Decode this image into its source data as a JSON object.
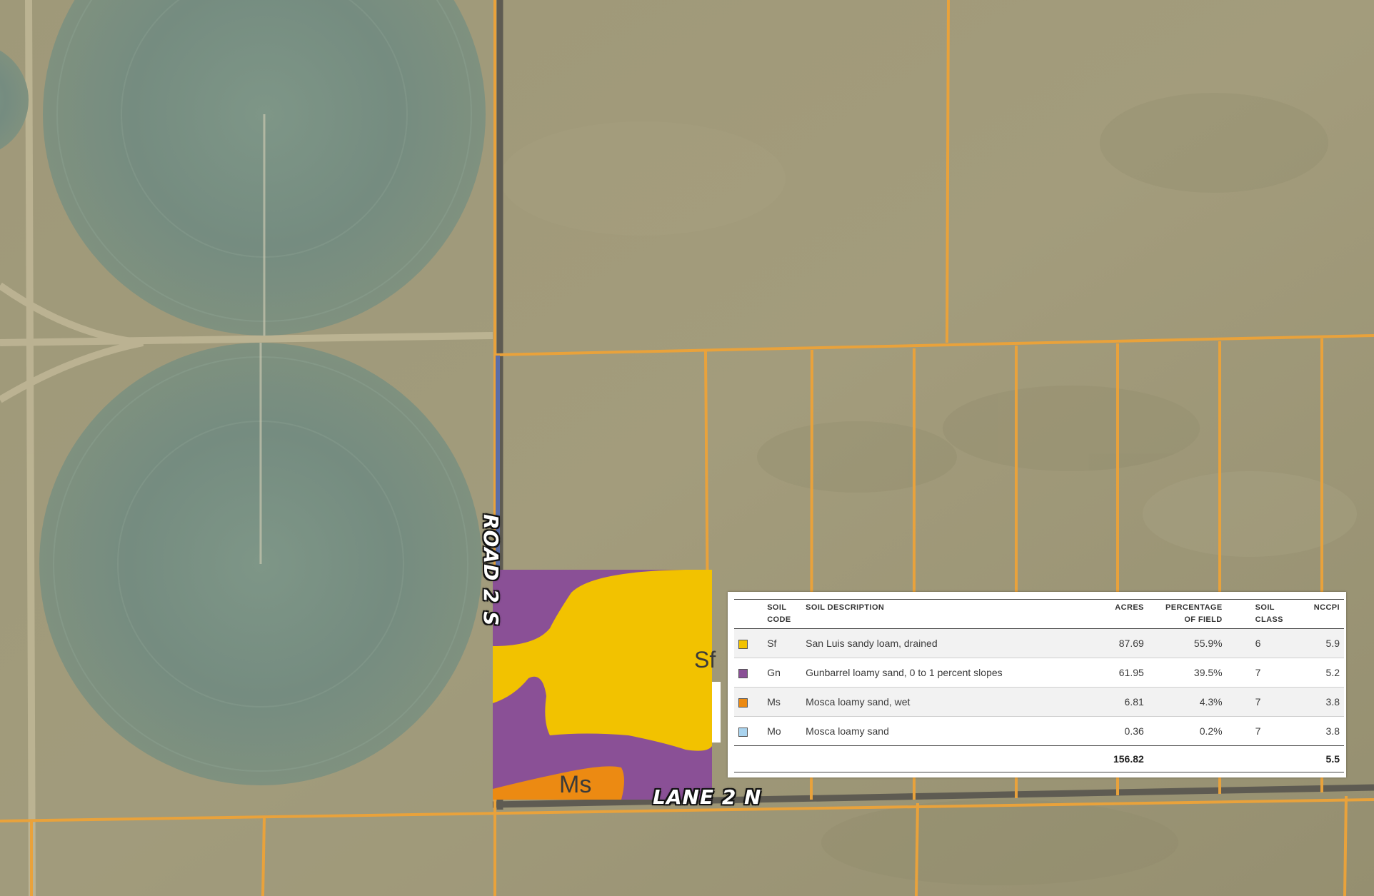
{
  "map": {
    "road_vertical_label": "ROAD 2 S",
    "road_horizontal_label": "LANE 2 N",
    "field_labels": [
      "Sf",
      "Ms"
    ],
    "colors": {
      "parcel_line": "#e9a23b",
      "field_boundary": "#5b6ea8",
      "Sf": "#f2c200",
      "Gn": "#8a5096",
      "Ms": "#ec8a12",
      "Mo": "#a9d3ee"
    }
  },
  "soil_table": {
    "headers": {
      "code": "SOIL CODE",
      "description": "SOIL DESCRIPTION",
      "acres": "ACRES",
      "percent": "PERCENTAGE OF FIELD",
      "class": "SOIL CLASS",
      "nccpi": "NCCPI"
    },
    "rows": [
      {
        "color": "#f2c200",
        "code": "Sf",
        "description": "San Luis sandy loam, drained",
        "acres": "87.69",
        "percent": "55.9%",
        "class": "6",
        "nccpi": "5.9"
      },
      {
        "color": "#8a5096",
        "code": "Gn",
        "description": "Gunbarrel loamy sand, 0 to 1 percent slopes",
        "acres": "61.95",
        "percent": "39.5%",
        "class": "7",
        "nccpi": "5.2"
      },
      {
        "color": "#ec8a12",
        "code": "Ms",
        "description": "Mosca loamy sand, wet",
        "acres": "6.81",
        "percent": "4.3%",
        "class": "7",
        "nccpi": "3.8"
      },
      {
        "color": "#a9d3ee",
        "code": "Mo",
        "description": "Mosca loamy sand",
        "acres": "0.36",
        "percent": "0.2%",
        "class": "7",
        "nccpi": "3.8"
      }
    ],
    "totals": {
      "acres": "156.82",
      "nccpi": "5.5"
    }
  }
}
